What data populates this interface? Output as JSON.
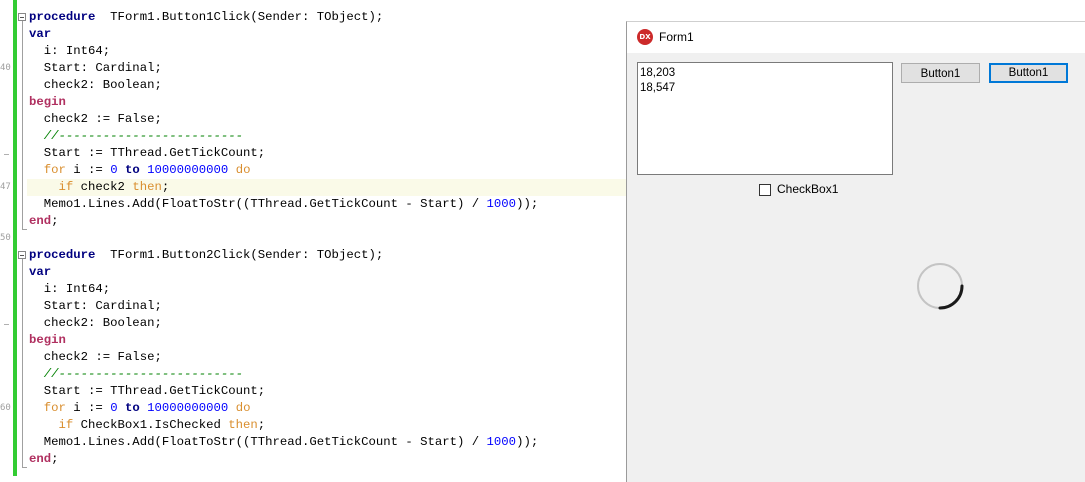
{
  "editor": {
    "gutter_numbers": [
      "40",
      "47",
      "50",
      "60"
    ],
    "lines": [
      {
        "parts": [
          [
            "kw",
            "procedure"
          ],
          [
            "",
            "  TForm1.Button1Click(Sender: TObject);"
          ]
        ]
      },
      {
        "parts": [
          [
            "kw",
            "var"
          ]
        ]
      },
      {
        "parts": [
          [
            "",
            "  i: Int64;"
          ]
        ]
      },
      {
        "parts": [
          [
            "",
            "  Start: Cardinal;"
          ]
        ]
      },
      {
        "parts": [
          [
            "",
            "  check2: Boolean;"
          ]
        ]
      },
      {
        "parts": [
          [
            "kwr",
            "begin"
          ]
        ]
      },
      {
        "parts": [
          [
            "",
            "  check2 := False;"
          ]
        ]
      },
      {
        "parts": [
          [
            "cm",
            "  //-------------------------"
          ]
        ]
      },
      {
        "parts": [
          [
            "",
            "  Start := TThread.GetTickCount;"
          ]
        ]
      },
      {
        "parts": [
          [
            "kwo",
            "  for"
          ],
          [
            "",
            " i := "
          ],
          [
            "num",
            "0"
          ],
          [
            "",
            " "
          ],
          [
            "kw",
            "to"
          ],
          [
            "",
            " "
          ],
          [
            "num",
            "10000000000"
          ],
          [
            "",
            " "
          ],
          [
            "kwo",
            "do"
          ]
        ]
      },
      {
        "parts": [
          [
            "kwo",
            "    if"
          ],
          [
            "",
            " check2 "
          ],
          [
            "kwo",
            "then"
          ],
          [
            "",
            ";"
          ]
        ]
      },
      {
        "parts": [
          [
            "",
            "  Memo1.Lines.Add(FloatToStr((TThread.GetTickCount - Start) / "
          ],
          [
            "num",
            "1000"
          ],
          [
            "",
            "));"
          ]
        ]
      },
      {
        "parts": [
          [
            "kwr",
            "end"
          ],
          [
            "",
            ";"
          ]
        ]
      },
      {
        "parts": []
      },
      {
        "parts": [
          [
            "kw",
            "procedure"
          ],
          [
            "",
            "  TForm1.Button2Click(Sender: TObject);"
          ]
        ]
      },
      {
        "parts": [
          [
            "kw",
            "var"
          ]
        ]
      },
      {
        "parts": [
          [
            "",
            "  i: Int64;"
          ]
        ]
      },
      {
        "parts": [
          [
            "",
            "  Start: Cardinal;"
          ]
        ]
      },
      {
        "parts": [
          [
            "",
            "  check2: Boolean;"
          ]
        ]
      },
      {
        "parts": [
          [
            "kwr",
            "begin"
          ]
        ]
      },
      {
        "parts": [
          [
            "",
            "  check2 := False;"
          ]
        ]
      },
      {
        "parts": [
          [
            "cm",
            "  //-------------------------"
          ]
        ]
      },
      {
        "parts": [
          [
            "",
            "  Start := TThread.GetTickCount;"
          ]
        ]
      },
      {
        "parts": [
          [
            "kwo",
            "  for"
          ],
          [
            "",
            " i := "
          ],
          [
            "num",
            "0"
          ],
          [
            "",
            " "
          ],
          [
            "kw",
            "to"
          ],
          [
            "",
            " "
          ],
          [
            "num",
            "10000000000"
          ],
          [
            "",
            " "
          ],
          [
            "kwo",
            "do"
          ]
        ]
      },
      {
        "parts": [
          [
            "kwo",
            "    if"
          ],
          [
            "",
            " CheckBox1.IsChecked "
          ],
          [
            "kwo",
            "then"
          ],
          [
            "",
            ";"
          ]
        ]
      },
      {
        "parts": [
          [
            "",
            "  Memo1.Lines.Add(FloatToStr((TThread.GetTickCount - Start) / "
          ],
          [
            "num",
            "1000"
          ],
          [
            "",
            "));"
          ]
        ]
      },
      {
        "parts": [
          [
            "kwr",
            "end"
          ],
          [
            "",
            ";"
          ]
        ]
      }
    ]
  },
  "form": {
    "icon_text": "DX",
    "title": "Form1",
    "memo_lines": [
      "18,203",
      "18,547"
    ],
    "button1_label": "Button1",
    "button2_label": "Button1",
    "checkbox_label": "CheckBox1",
    "checkbox_checked": false
  },
  "colors": {
    "change_bar": "#33cc33",
    "keyword": "#000080",
    "begin_end": "#b03060",
    "control_keyword": "#d98e2e",
    "number": "#0000ff",
    "comment": "#008000",
    "focus_border": "#0078d7"
  }
}
